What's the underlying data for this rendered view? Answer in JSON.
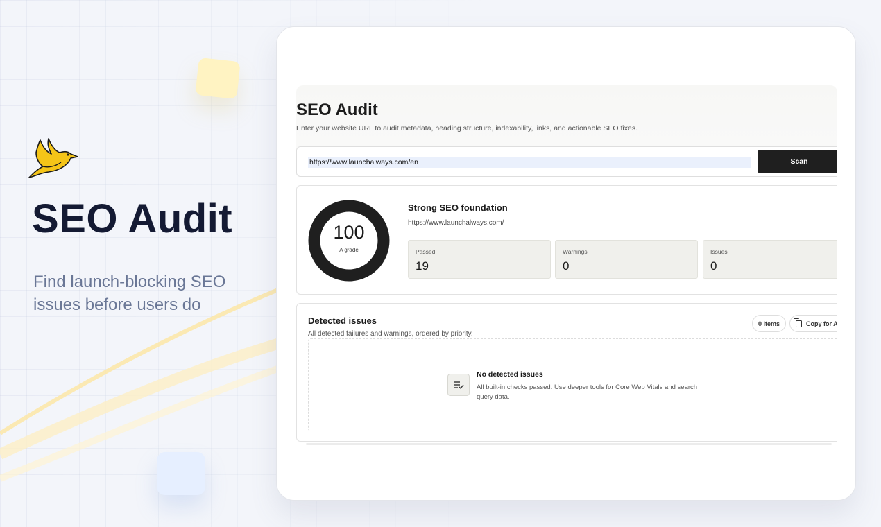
{
  "hero": {
    "title": "SEO Audit",
    "subtitle": "Find launch-blocking SEO issues before users do",
    "logo_icon": "bird-logo-icon",
    "colors": {
      "title": "#141a33",
      "subtitle": "#6a7796",
      "logo": "#f5c518"
    }
  },
  "app": {
    "title": "SEO Audit",
    "description": "Enter your website URL to audit metadata, heading structure, indexability, links, and actionable SEO fixes.",
    "url_input_value": "https://www.launchalways.com/en",
    "scan_label": "Scan",
    "score": {
      "value": "100",
      "grade": "A grade",
      "progress_fraction": 1.0,
      "headline": "Strong SEO foundation",
      "url": "https://www.launchalways.com/"
    },
    "stats": [
      {
        "label": "Passed",
        "value": "19"
      },
      {
        "label": "Warnings",
        "value": "0"
      },
      {
        "label": "Issues",
        "value": "0"
      }
    ],
    "issues": {
      "title": "Detected issues",
      "description": "All detected failures and warnings, ordered by priority.",
      "count_label": "0 items",
      "copy_label": "Copy for AI",
      "copy_icon": "copy-icon",
      "empty_icon": "checklist-icon",
      "empty_title": "No detected issues",
      "empty_description": "All built-in checks passed. Use deeper tools for Core Web Vitals and search query data."
    },
    "colors": {
      "scan_button": "#1f1f1f",
      "gauge": "#1f1f1f",
      "input_highlight": "#eaf0fc"
    }
  }
}
